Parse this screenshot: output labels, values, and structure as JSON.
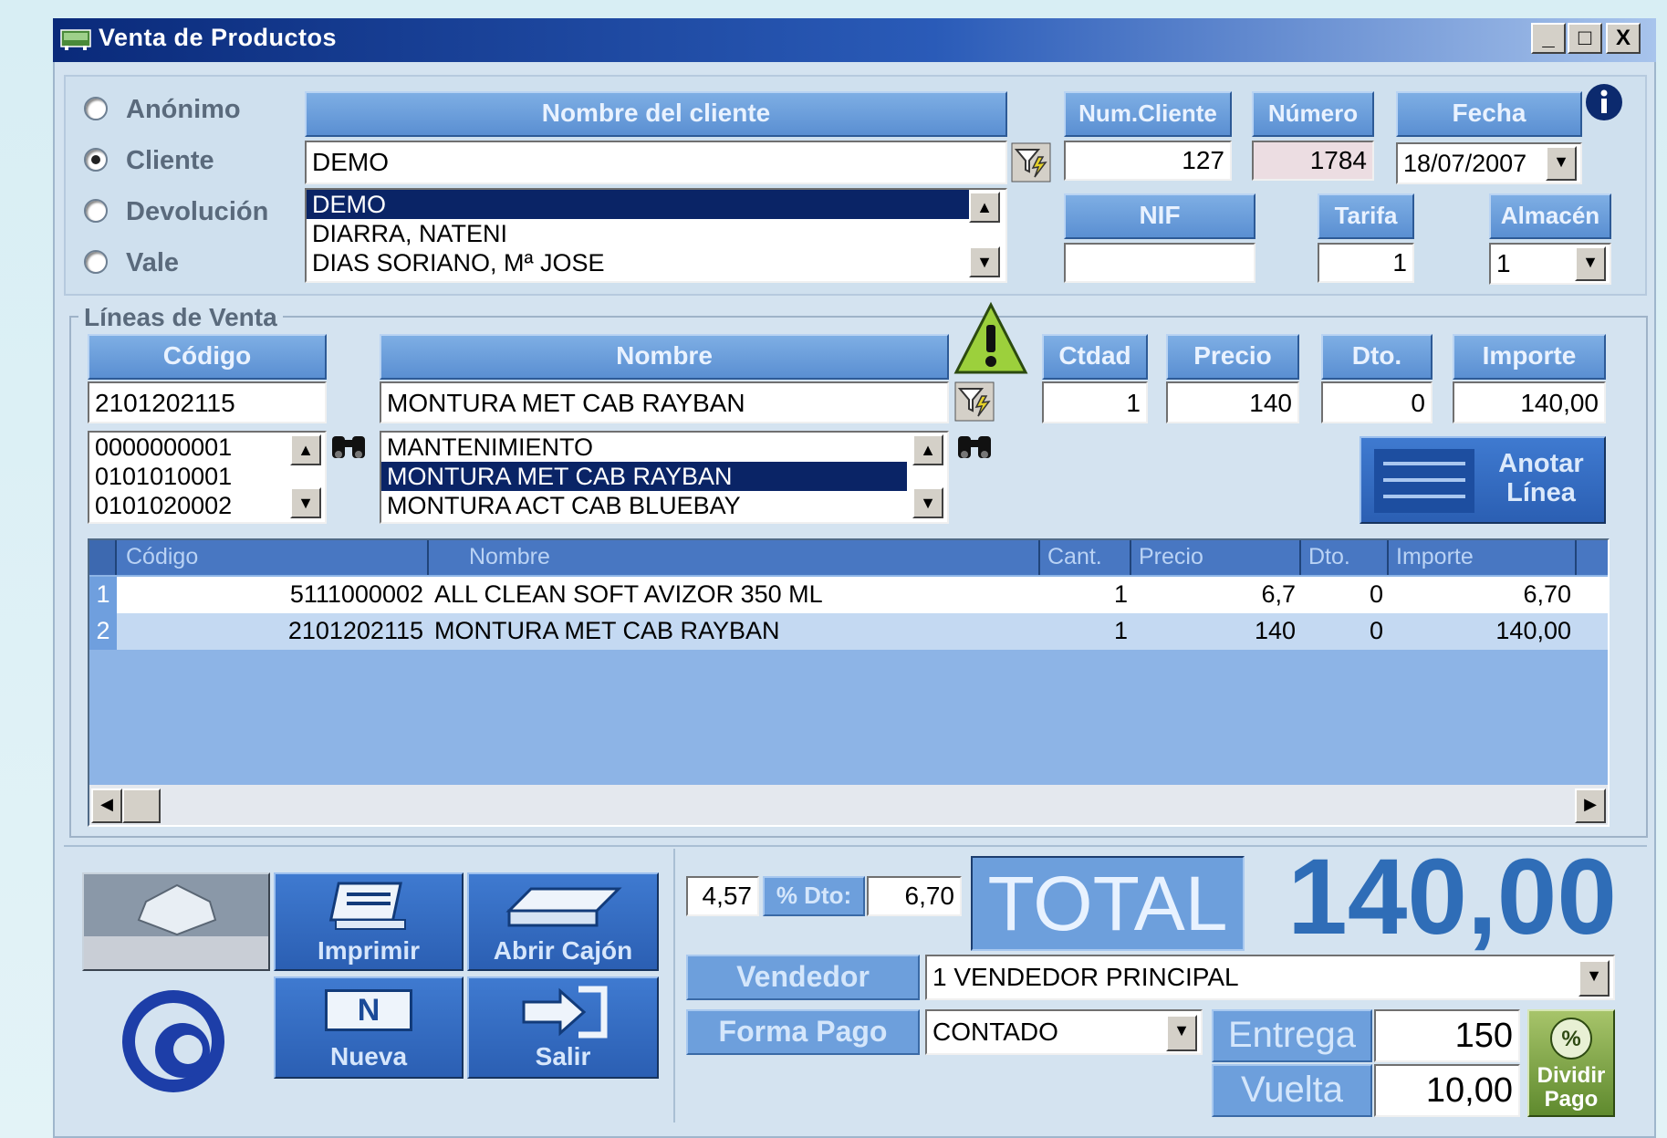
{
  "window": {
    "title": "Venta de Productos",
    "controls": {
      "minimize": "_",
      "maximize": "□",
      "close": "X"
    }
  },
  "client_type": {
    "options": [
      {
        "label": "Anónimo",
        "checked": false
      },
      {
        "label": "Cliente",
        "checked": true
      },
      {
        "label": "Devolución",
        "checked": false
      },
      {
        "label": "Vale",
        "checked": false
      }
    ]
  },
  "client": {
    "name_header": "Nombre del cliente",
    "name_value": "DEMO",
    "list": [
      "DEMO",
      "DIARRA, NATENI",
      "DIAS SORIANO, Mª JOSE"
    ],
    "selected_index": 0,
    "num_header": "Num.Cliente",
    "num_value": "127",
    "numero_header": "Número",
    "numero_value": "1784",
    "fecha_header": "Fecha",
    "fecha_value": "18/07/2007",
    "nif_header": "NIF",
    "nif_value": "",
    "tarifa_header": "Tarifa",
    "tarifa_value": "1",
    "almacen_header": "Almacén",
    "almacen_value": "1"
  },
  "lineas": {
    "group_label": "Líneas de Venta",
    "codigo_header": "Código",
    "codigo_value": "2101202115",
    "codigo_list": [
      "0000000001",
      "0101010001",
      "0101020002"
    ],
    "nombre_header": "Nombre",
    "nombre_value": "MONTURA  MET CAB RAYBAN",
    "nombre_list": [
      "MANTENIMIENTO",
      "MONTURA  MET CAB RAYBAN",
      "MONTURA ACT CAB BLUEBAY"
    ],
    "nombre_selected_index": 1,
    "ctdad_header": "Ctdad",
    "ctdad_value": "1",
    "precio_header": "Precio",
    "precio_value": "140",
    "dto_header": "Dto.",
    "dto_value": "0",
    "importe_header": "Importe",
    "importe_value": "140,00",
    "anotar_label_1": "Anotar",
    "anotar_label_2": "Línea"
  },
  "grid": {
    "columns": [
      "Código",
      "Nombre",
      "Cant.",
      "Precio",
      "Dto.",
      "Importe"
    ],
    "rows": [
      {
        "num": "1",
        "codigo": "5111000002",
        "nombre": "ALL CLEAN SOFT AVIZOR 350 ML",
        "cant": "1",
        "precio": "6,7",
        "dto": "0",
        "importe": "6,70"
      },
      {
        "num": "2",
        "codigo": "2101202115",
        "nombre": "MONTURA  MET CAB RAYBAN",
        "cant": "1",
        "precio": "140",
        "dto": "0",
        "importe": "140,00"
      }
    ]
  },
  "totals": {
    "dto_pct": "4,57",
    "dto_label": "% Dto:",
    "dto_amount": "6,70",
    "total_label": "TOTAL",
    "total_value": "140,00",
    "vendedor_label": "Vendedor",
    "vendedor_value": "1 VENDEDOR PRINCIPAL",
    "forma_pago_label": "Forma Pago",
    "forma_pago_value": "CONTADO",
    "entrega_label": "Entrega",
    "entrega_value": "150",
    "vuelta_label": "Vuelta",
    "vuelta_value": "10,00",
    "dividir_label_1": "Dividir",
    "dividir_label_2": "Pago"
  },
  "actions": {
    "imprimir": "Imprimir",
    "abrir_cajon": "Abrir Cajón",
    "nueva": "Nueva",
    "salir": "Salir",
    "nueva_icon_letter": "N"
  },
  "colors": {
    "title_bar": "#0a2a7a",
    "header_blue": "#5a8fd2",
    "total_blue": "#2f6db7",
    "selection": "#0a2466"
  }
}
